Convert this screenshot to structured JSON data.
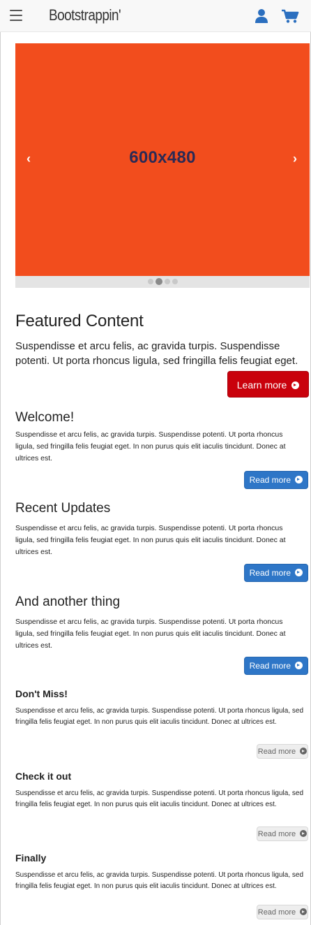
{
  "navbar": {
    "brand": "Bootstrappin'",
    "icons": [
      "hamburger-icon",
      "user-icon",
      "cart-icon"
    ]
  },
  "carousel": {
    "slide_label": "600x480",
    "prev_glyph": "‹",
    "next_glyph": "›",
    "indicator_count": 4,
    "active_index": 1,
    "slide_color": "#f24d1d"
  },
  "featured": {
    "title": "Featured Content",
    "body": "Suspendisse et arcu felis, ac gravida turpis. Suspendisse potenti. Ut porta rhoncus ligula, sed fringilla felis feugiat eget.",
    "button_label": "Learn more",
    "button_color": "#c9010c"
  },
  "sections": [
    {
      "title": "Welcome!",
      "body": "Suspendisse et arcu felis, ac gravida turpis. Suspendisse potenti. Ut porta rhoncus ligula, sed fringilla felis feugiat eget. In non purus quis elit iaculis tincidunt. Donec at ultrices est.",
      "button_label": "Read more"
    },
    {
      "title": "Recent Updates",
      "body": "Suspendisse et arcu felis, ac gravida turpis. Suspendisse potenti. Ut porta rhoncus ligula, sed fringilla felis feugiat eget. In non purus quis elit iaculis tincidunt. Donec at ultrices est.",
      "button_label": "Read more"
    },
    {
      "title": "And another thing",
      "body": "Suspendisse et arcu felis, ac gravida turpis. Suspendisse potenti. Ut porta rhoncus ligula, sed fringilla felis feugiat eget. In non purus quis elit iaculis tincidunt. Donec at ultrices est.",
      "button_label": "Read more"
    }
  ],
  "minor_sections": [
    {
      "title": "Don't Miss!",
      "body": "Suspendisse et arcu felis, ac gravida turpis. Suspendisse potenti. Ut porta rhoncus ligula, sed fringilla felis feugiat eget. In non purus quis elit iaculis tincidunt. Donec at ultrices est.",
      "button_label": "Read more"
    },
    {
      "title": "Check it out",
      "body": "Suspendisse et arcu felis, ac gravida turpis. Suspendisse potenti. Ut porta rhoncus ligula, sed fringilla felis feugiat eget. In non purus quis elit iaculis tincidunt. Donec at ultrices est.",
      "button_label": "Read more"
    },
    {
      "title": "Finally",
      "body": "Suspendisse et arcu felis, ac gravida turpis. Suspendisse potenti. Ut porta rhoncus ligula, sed fringilla felis feugiat eget. In non purus quis elit iaculis tincidunt. Donec at ultrices est.",
      "button_label": "Read more"
    }
  ],
  "colors": {
    "primary_blue": "#2e76c7",
    "navbar_icon": "#2b6fbf"
  }
}
